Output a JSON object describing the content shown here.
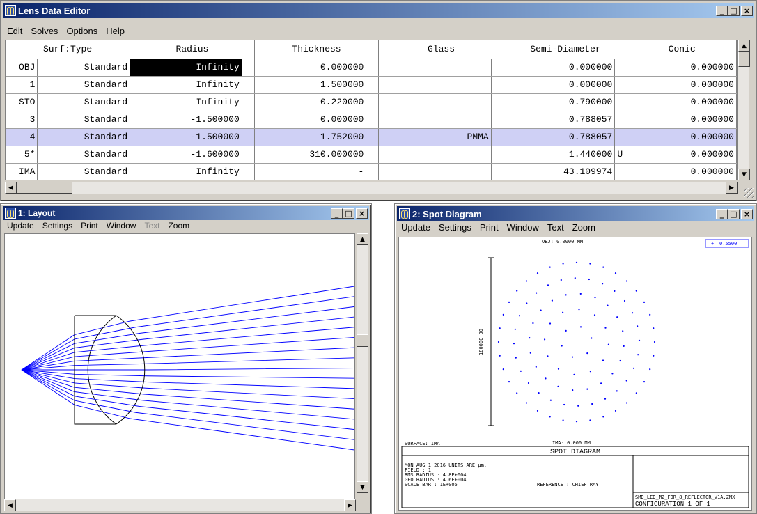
{
  "lde": {
    "title": "Lens Data Editor",
    "menu": [
      "Edit",
      "Solves",
      "Options",
      "Help"
    ],
    "columns": [
      "Surf:Type",
      "Radius",
      "Thickness",
      "Glass",
      "Semi-Diameter",
      "Conic"
    ],
    "rows": [
      {
        "surf": "OBJ",
        "type": "Standard",
        "radius": "Infinity",
        "thickness": "0.000000",
        "glass": "",
        "semi": "0.000000",
        "semi_flag": "",
        "conic": "0.000000"
      },
      {
        "surf": "1",
        "type": "Standard",
        "radius": "Infinity",
        "thickness": "1.500000",
        "glass": "",
        "semi": "0.000000",
        "semi_flag": "",
        "conic": "0.000000"
      },
      {
        "surf": "STO",
        "type": "Standard",
        "radius": "Infinity",
        "thickness": "0.220000",
        "glass": "",
        "semi": "0.790000",
        "semi_flag": "",
        "conic": "0.000000"
      },
      {
        "surf": "3",
        "type": "Standard",
        "radius": "-1.500000",
        "thickness": "0.000000",
        "glass": "",
        "semi": "0.788057",
        "semi_flag": "",
        "conic": "0.000000"
      },
      {
        "surf": "4",
        "type": "Standard",
        "radius": "-1.500000",
        "thickness": "1.752000",
        "glass": "PMMA",
        "semi": "0.788057",
        "semi_flag": "",
        "conic": "0.000000"
      },
      {
        "surf": "5*",
        "type": "Standard",
        "radius": "-1.600000",
        "thickness": "310.000000",
        "glass": "",
        "semi": "1.440000",
        "semi_flag": "U",
        "conic": "0.000000"
      },
      {
        "surf": "IMA",
        "type": "Standard",
        "radius": "Infinity",
        "thickness": "-",
        "glass": "",
        "semi": "43.109974",
        "semi_flag": "",
        "conic": "0.000000"
      }
    ],
    "selected_row": 4,
    "highlight": {
      "row": 0,
      "col": "radius"
    }
  },
  "layout": {
    "title": "1: Layout",
    "menu": [
      {
        "label": "Update",
        "disabled": false
      },
      {
        "label": "Settings",
        "disabled": false
      },
      {
        "label": "Print",
        "disabled": false
      },
      {
        "label": "Window",
        "disabled": false
      },
      {
        "label": "Text",
        "disabled": true
      },
      {
        "label": "Zoom",
        "disabled": false
      }
    ],
    "ray_color": "#0000ff"
  },
  "spot": {
    "title": "2: Spot Diagram",
    "menu": [
      "Update",
      "Settings",
      "Print",
      "Window",
      "Text",
      "Zoom"
    ],
    "obj_label": "OBJ: 0.0000 MM",
    "wavelength_label": "0.5500",
    "scale_label": "180000.00",
    "ima_label": "IMA: 0.000 MM",
    "surface_label": "SURFACE: IMA",
    "panel_title": "SPOT DIAGRAM",
    "info_lines": [
      "MON AUG 1 2016  UNITS ARE µm.",
      "FIELD      :           1",
      "RMS RADIUS :     4.8E+004",
      "GEO RADIUS :     4.6E+004",
      "SCALE BAR  :   1E+005"
    ],
    "reference": "REFERENCE  : CHIEF RAY",
    "filename": "SMD_LED_M2_FOR_8_REFLECTOR_V1A.ZMX",
    "configuration": "CONFIGURATION  1  OF  1",
    "dot_color": "#0000ff"
  }
}
